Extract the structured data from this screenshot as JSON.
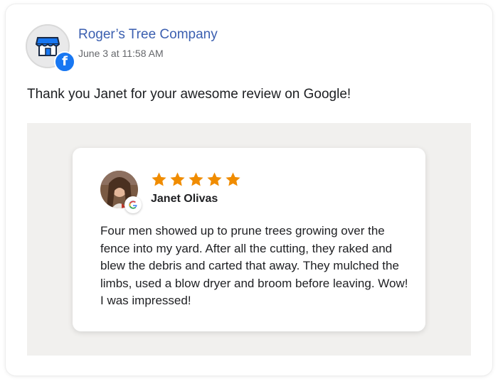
{
  "post": {
    "page_name": "Roger’s Tree Company",
    "timestamp": "June 3 at 11:58 AM",
    "text": "Thank you Janet for your awesome review on Google!",
    "avatar_icon": "storefront-icon",
    "badge_icon": "facebook-icon"
  },
  "review": {
    "reviewer_name": "Janet Olivas",
    "rating": 5,
    "max_rating": 5,
    "source_icon": "google-icon",
    "text": "Four men showed up to prune trees growing over the fence into my yard. After all the cutting, they raked and blew the debris and carted that away. They mulched the limbs, used a blow dryer and broom before leaving. Wow! I was impressed!"
  },
  "colors": {
    "facebook_blue": "#1877f2",
    "page_name": "#3b5fb0",
    "star": "#f08c00",
    "media_bg": "#f1f0ee"
  }
}
